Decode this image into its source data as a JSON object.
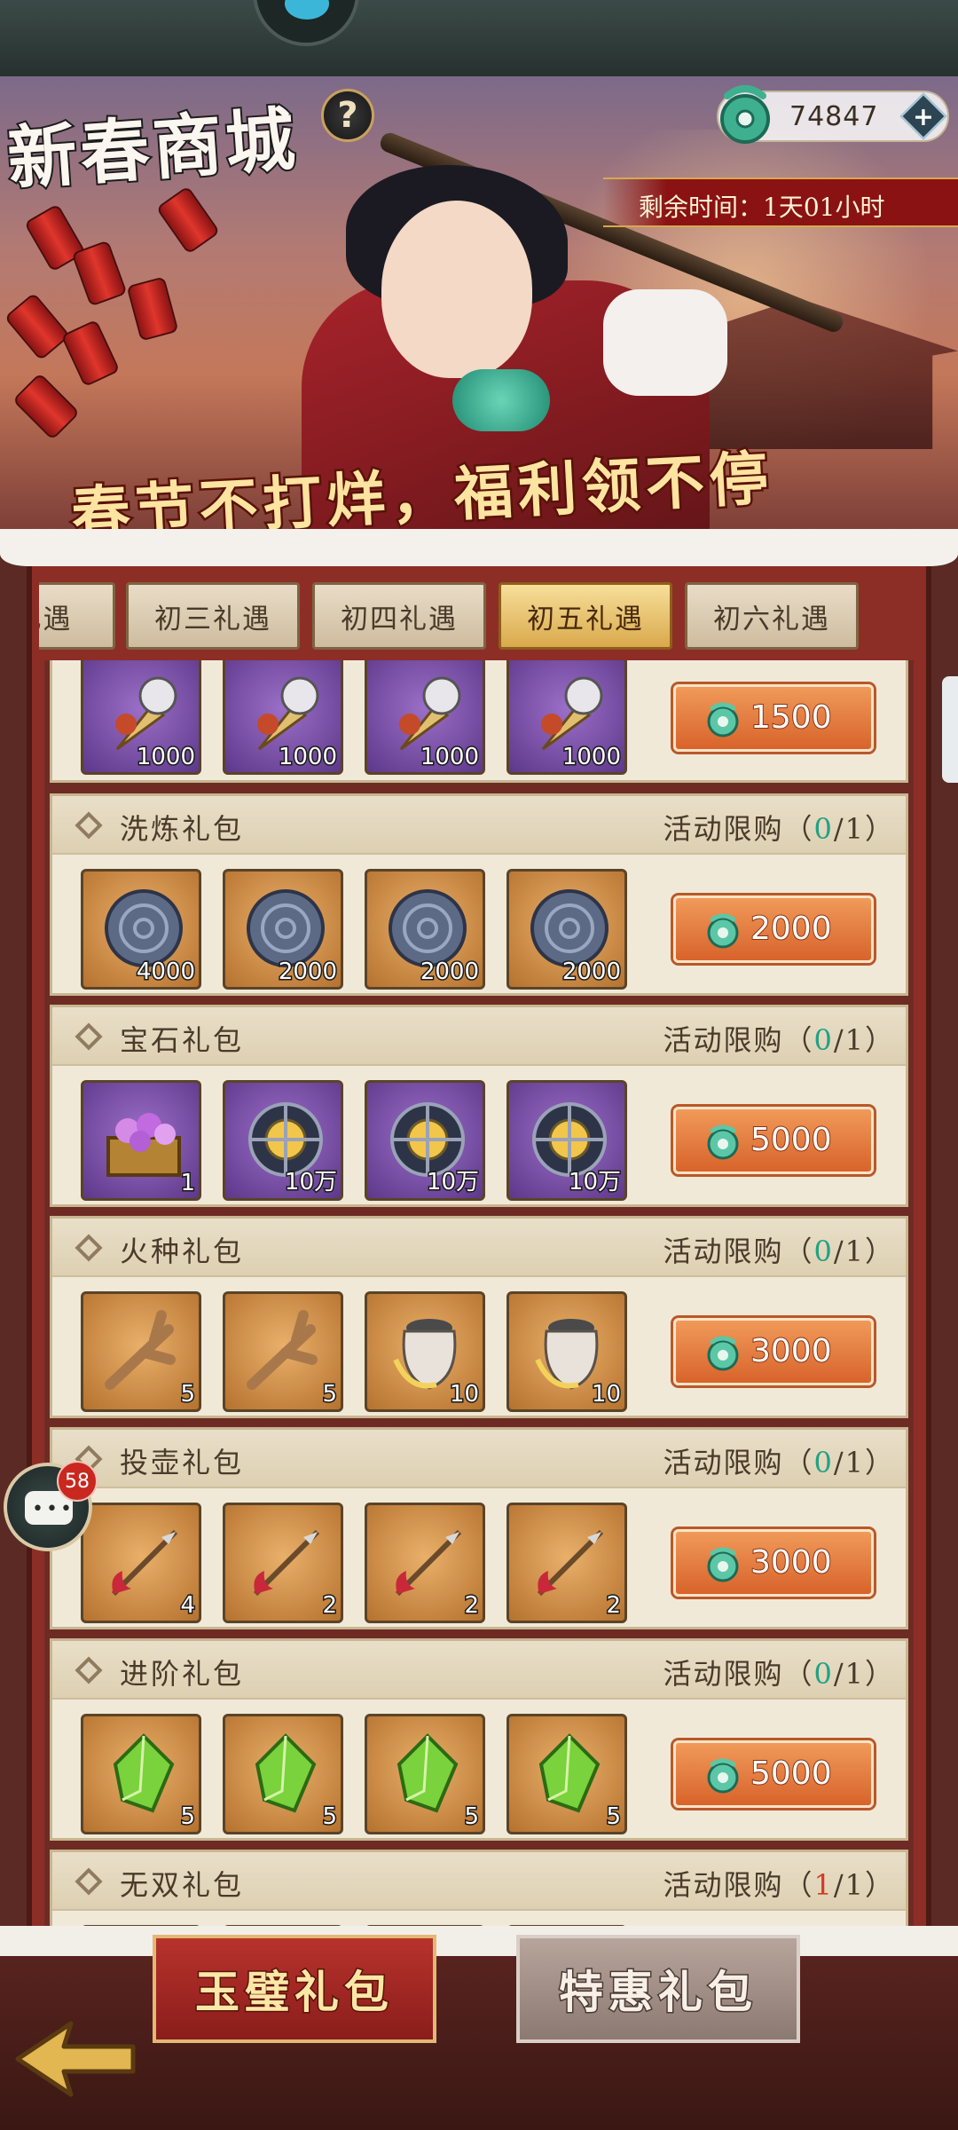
{
  "header": {
    "title": "新春商城",
    "help_label": "?",
    "currency_amount": "74847",
    "currency_add_label": "+",
    "timer_text": "剩余时间：1天01小时",
    "slogan": "春节不打烊，福利领不停"
  },
  "tabs": [
    {
      "label": "二礼遇"
    },
    {
      "label": "初三礼遇"
    },
    {
      "label": "初四礼遇"
    },
    {
      "label": "初五礼遇",
      "active": true
    },
    {
      "label": "初六礼遇"
    }
  ],
  "packs": [
    {
      "name": "",
      "limit": "",
      "price": "1500",
      "items": [
        {
          "icon": "wolf-dagger",
          "qty": "1000",
          "bg": "purple"
        },
        {
          "icon": "wolf-dagger",
          "qty": "1000",
          "bg": "purple"
        },
        {
          "icon": "wolf-dagger",
          "qty": "1000",
          "bg": "purple"
        },
        {
          "icon": "wolf-dagger",
          "qty": "1000",
          "bg": "purple"
        }
      ]
    },
    {
      "name": "洗炼礼包",
      "limit_prefix": "活动限购（",
      "limit_count": "0",
      "limit_suffix": "/1）",
      "price": "2000",
      "items": [
        {
          "icon": "stone-disc",
          "qty": "4000",
          "bg": "orange"
        },
        {
          "icon": "stone-disc",
          "qty": "2000",
          "bg": "orange"
        },
        {
          "icon": "stone-disc",
          "qty": "2000",
          "bg": "orange"
        },
        {
          "icon": "stone-disc",
          "qty": "2000",
          "bg": "orange"
        }
      ]
    },
    {
      "name": "宝石礼包",
      "limit_prefix": "活动限购（",
      "limit_count": "0",
      "limit_suffix": "/1）",
      "price": "5000",
      "items": [
        {
          "icon": "gem-chest",
          "qty": "1",
          "bg": "purple"
        },
        {
          "icon": "cage-orb",
          "qty": "10万",
          "bg": "purple"
        },
        {
          "icon": "cage-orb",
          "qty": "10万",
          "bg": "purple"
        },
        {
          "icon": "cage-orb",
          "qty": "10万",
          "bg": "purple"
        }
      ]
    },
    {
      "name": "火种礼包",
      "limit_prefix": "活动限购（",
      "limit_count": "0",
      "limit_suffix": "/1）",
      "price": "3000",
      "items": [
        {
          "icon": "branch",
          "qty": "5",
          "bg": "orange"
        },
        {
          "icon": "branch",
          "qty": "5",
          "bg": "orange"
        },
        {
          "icon": "jar",
          "qty": "10",
          "bg": "orange"
        },
        {
          "icon": "jar",
          "qty": "10",
          "bg": "orange"
        }
      ]
    },
    {
      "name": "投壶礼包",
      "limit_prefix": "活动限购（",
      "limit_count": "0",
      "limit_suffix": "/1）",
      "price": "3000",
      "items": [
        {
          "icon": "arrow",
          "qty": "4",
          "bg": "orange"
        },
        {
          "icon": "arrow",
          "qty": "2",
          "bg": "orange"
        },
        {
          "icon": "arrow",
          "qty": "2",
          "bg": "orange"
        },
        {
          "icon": "arrow",
          "qty": "2",
          "bg": "orange"
        }
      ]
    },
    {
      "name": "进阶礼包",
      "limit_prefix": "活动限购（",
      "limit_count": "0",
      "limit_suffix": "/1）",
      "price": "5000",
      "items": [
        {
          "icon": "green-crystal",
          "qty": "5",
          "bg": "orange"
        },
        {
          "icon": "green-crystal",
          "qty": "5",
          "bg": "orange"
        },
        {
          "icon": "green-crystal",
          "qty": "5",
          "bg": "orange"
        },
        {
          "icon": "green-crystal",
          "qty": "5",
          "bg": "orange"
        }
      ]
    },
    {
      "name": "无双礼包",
      "limit_prefix": "活动限购（",
      "limit_count": "1",
      "limit_suffix": "/1）",
      "price": "",
      "items": []
    }
  ],
  "chat": {
    "badge": "58"
  },
  "bottom_tabs": [
    {
      "label": "玉璧礼包",
      "active": true
    },
    {
      "label": "特惠礼包",
      "active": false
    }
  ],
  "colors": {
    "accent_orange": "#d8632b",
    "limit_green": "#22a184",
    "limit_red": "#d23a2a",
    "frame_red": "#8c2e26"
  }
}
